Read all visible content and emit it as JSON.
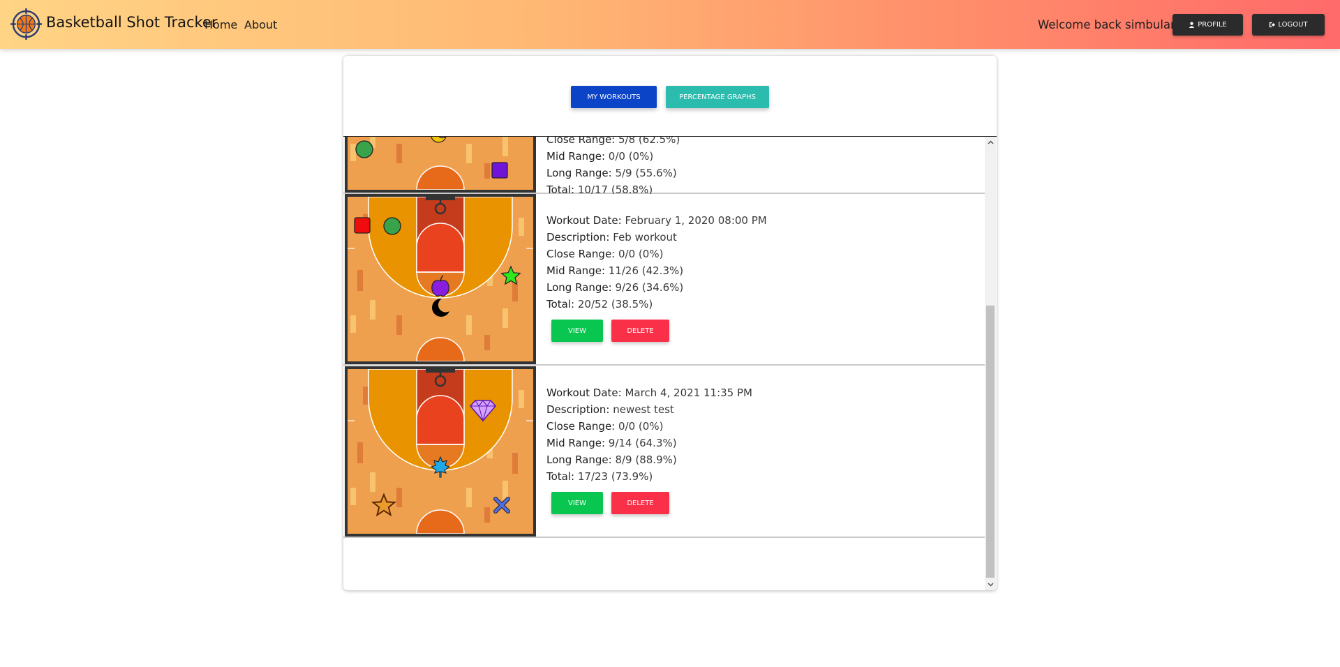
{
  "navbar": {
    "brand": "Basketball Shot Tracker",
    "links": [
      "Home",
      "About"
    ],
    "welcome": "Welcome back simbulan.c!",
    "profile_label": "Profile",
    "logout_label": "Logout"
  },
  "tabs": {
    "workouts_label": "My Workouts",
    "graphs_label": "Percentage Graphs"
  },
  "labels": {
    "date": "Workout Date:",
    "description": "Description:",
    "close": "Close Range:",
    "mid": "Mid Range:",
    "long": "Long Range:",
    "total": "Total:",
    "view": "View",
    "delete": "Delete"
  },
  "workouts": [
    {
      "close": "5/8 (62.5%)",
      "mid": "0/0 (0%)",
      "long": "5/9 (55.6%)",
      "total": "10/17 (58.8%)",
      "markers": [
        "green-circle-icon",
        "yellow-moon-icon",
        "purple-square-icon"
      ]
    },
    {
      "date": "February 1, 2020 08:00 PM",
      "description": "Feb workout",
      "close": "0/0 (0%)",
      "mid": "11/26 (42.3%)",
      "long": "9/26 (34.6%)",
      "total": "20/52 (38.5%)",
      "markers": [
        "red-square-icon",
        "green-circle-icon",
        "purple-apple-icon",
        "green-star-icon",
        "black-moon-icon"
      ]
    },
    {
      "date": "March 4, 2021 11:35 PM",
      "description": "newest test",
      "close": "0/0 (0%)",
      "mid": "9/14 (64.3%)",
      "long": "8/9 (88.9%)",
      "total": "17/23 (73.9%)",
      "markers": [
        "purple-diamond-icon",
        "blue-maple-leaf-icon",
        "orange-star-icon",
        "blue-x-icon"
      ]
    }
  ],
  "colors": {
    "nav_gradient": [
      "#ffd485",
      "#ff6a6a"
    ],
    "workouts_button": "#0b44c6",
    "graphs_button": "#2bbcae",
    "view_button": "#08c64f",
    "delete_button": "#fa3048",
    "court_floor": "#efa04e",
    "court_key": "#c43c1c",
    "court_arc": "#e99300"
  }
}
